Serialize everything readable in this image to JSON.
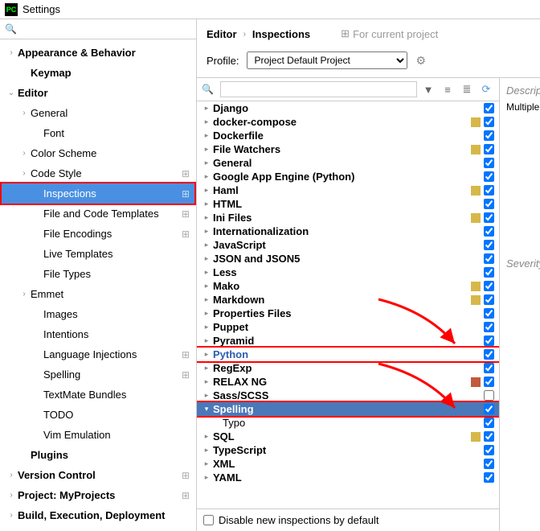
{
  "window": {
    "title": "Settings"
  },
  "search": {
    "placeholder": ""
  },
  "sidebar": {
    "items": [
      {
        "label": "Appearance & Behavior",
        "indent": 0,
        "arrow": ">",
        "bold": true,
        "gear": false
      },
      {
        "label": "Keymap",
        "indent": 1,
        "arrow": "",
        "bold": true,
        "gear": false
      },
      {
        "label": "Editor",
        "indent": 0,
        "arrow": "v",
        "bold": true,
        "gear": false
      },
      {
        "label": "General",
        "indent": 1,
        "arrow": ">",
        "bold": false,
        "gear": false
      },
      {
        "label": "Font",
        "indent": 2,
        "arrow": "",
        "bold": false,
        "gear": false
      },
      {
        "label": "Color Scheme",
        "indent": 1,
        "arrow": ">",
        "bold": false,
        "gear": false
      },
      {
        "label": "Code Style",
        "indent": 1,
        "arrow": ">",
        "bold": false,
        "gear": true
      },
      {
        "label": "Inspections",
        "indent": 2,
        "arrow": "",
        "bold": false,
        "gear": true,
        "selected": true,
        "redbox": true
      },
      {
        "label": "File and Code Templates",
        "indent": 2,
        "arrow": "",
        "bold": false,
        "gear": true
      },
      {
        "label": "File Encodings",
        "indent": 2,
        "arrow": "",
        "bold": false,
        "gear": true
      },
      {
        "label": "Live Templates",
        "indent": 2,
        "arrow": "",
        "bold": false,
        "gear": false
      },
      {
        "label": "File Types",
        "indent": 2,
        "arrow": "",
        "bold": false,
        "gear": false
      },
      {
        "label": "Emmet",
        "indent": 1,
        "arrow": ">",
        "bold": false,
        "gear": false
      },
      {
        "label": "Images",
        "indent": 2,
        "arrow": "",
        "bold": false,
        "gear": false
      },
      {
        "label": "Intentions",
        "indent": 2,
        "arrow": "",
        "bold": false,
        "gear": false
      },
      {
        "label": "Language Injections",
        "indent": 2,
        "arrow": "",
        "bold": false,
        "gear": true
      },
      {
        "label": "Spelling",
        "indent": 2,
        "arrow": "",
        "bold": false,
        "gear": true
      },
      {
        "label": "TextMate Bundles",
        "indent": 2,
        "arrow": "",
        "bold": false,
        "gear": false
      },
      {
        "label": "TODO",
        "indent": 2,
        "arrow": "",
        "bold": false,
        "gear": false
      },
      {
        "label": "Vim Emulation",
        "indent": 2,
        "arrow": "",
        "bold": false,
        "gear": false
      },
      {
        "label": "Plugins",
        "indent": 1,
        "arrow": "",
        "bold": true,
        "gear": false
      },
      {
        "label": "Version Control",
        "indent": 0,
        "arrow": ">",
        "bold": true,
        "gear": true
      },
      {
        "label": "Project: MyProjects",
        "indent": 0,
        "arrow": ">",
        "bold": true,
        "gear": true
      },
      {
        "label": "Build, Execution, Deployment",
        "indent": 0,
        "arrow": ">",
        "bold": true,
        "gear": false
      }
    ]
  },
  "breadcrumb": {
    "root": "Editor",
    "current": "Inspections",
    "project": "For current project"
  },
  "profile": {
    "label": "Profile:",
    "selected": "Project Default Project"
  },
  "inspections": {
    "search_placeholder": "",
    "items": [
      {
        "label": "Django",
        "arrow": ">",
        "color": "",
        "checked": true
      },
      {
        "label": "docker-compose",
        "arrow": ">",
        "color": "#d6b84a",
        "checked": true
      },
      {
        "label": "Dockerfile",
        "arrow": ">",
        "color": "",
        "checked": true
      },
      {
        "label": "File Watchers",
        "arrow": ">",
        "color": "#d6b84a",
        "checked": true
      },
      {
        "label": "General",
        "arrow": ">",
        "color": "",
        "checked": true
      },
      {
        "label": "Google App Engine (Python)",
        "arrow": ">",
        "color": "",
        "checked": true
      },
      {
        "label": "Haml",
        "arrow": ">",
        "color": "#d6b84a",
        "checked": true
      },
      {
        "label": "HTML",
        "arrow": ">",
        "color": "",
        "checked": true
      },
      {
        "label": "Ini Files",
        "arrow": ">",
        "color": "#d6b84a",
        "checked": true
      },
      {
        "label": "Internationalization",
        "arrow": ">",
        "color": "",
        "checked": true
      },
      {
        "label": "JavaScript",
        "arrow": ">",
        "color": "",
        "checked": true
      },
      {
        "label": "JSON and JSON5",
        "arrow": ">",
        "color": "",
        "checked": true
      },
      {
        "label": "Less",
        "arrow": ">",
        "color": "",
        "checked": true
      },
      {
        "label": "Mako",
        "arrow": ">",
        "color": "#d6b84a",
        "checked": true
      },
      {
        "label": "Markdown",
        "arrow": ">",
        "color": "#d6b84a",
        "checked": true
      },
      {
        "label": "Properties Files",
        "arrow": ">",
        "color": "",
        "checked": true
      },
      {
        "label": "Puppet",
        "arrow": ">",
        "color": "",
        "checked": true
      },
      {
        "label": "Pyramid",
        "arrow": ">",
        "color": "",
        "checked": true
      },
      {
        "label": "Python",
        "arrow": ">",
        "color": "",
        "checked": true,
        "link": true,
        "redbox": true
      },
      {
        "label": "RegExp",
        "arrow": ">",
        "color": "",
        "checked": true
      },
      {
        "label": "RELAX NG",
        "arrow": ">",
        "color": "#c15a3e",
        "checked": true
      },
      {
        "label": "Sass/SCSS",
        "arrow": ">",
        "color": "",
        "checked": false
      },
      {
        "label": "Spelling",
        "arrow": "v",
        "color": "",
        "checked": true,
        "selected": true,
        "redbox": true
      },
      {
        "label": "Typo",
        "arrow": "",
        "color": "",
        "checked": true,
        "child": true
      },
      {
        "label": "SQL",
        "arrow": ">",
        "color": "#d6b84a",
        "checked": true
      },
      {
        "label": "TypeScript",
        "arrow": ">",
        "color": "",
        "checked": true
      },
      {
        "label": "XML",
        "arrow": ">",
        "color": "",
        "checked": true
      },
      {
        "label": "YAML",
        "arrow": ">",
        "color": "",
        "checked": true
      }
    ],
    "disable_label": "Disable new inspections by default"
  },
  "description": {
    "heading": "Description",
    "body": "Multiple single i",
    "severity": "Severity"
  }
}
